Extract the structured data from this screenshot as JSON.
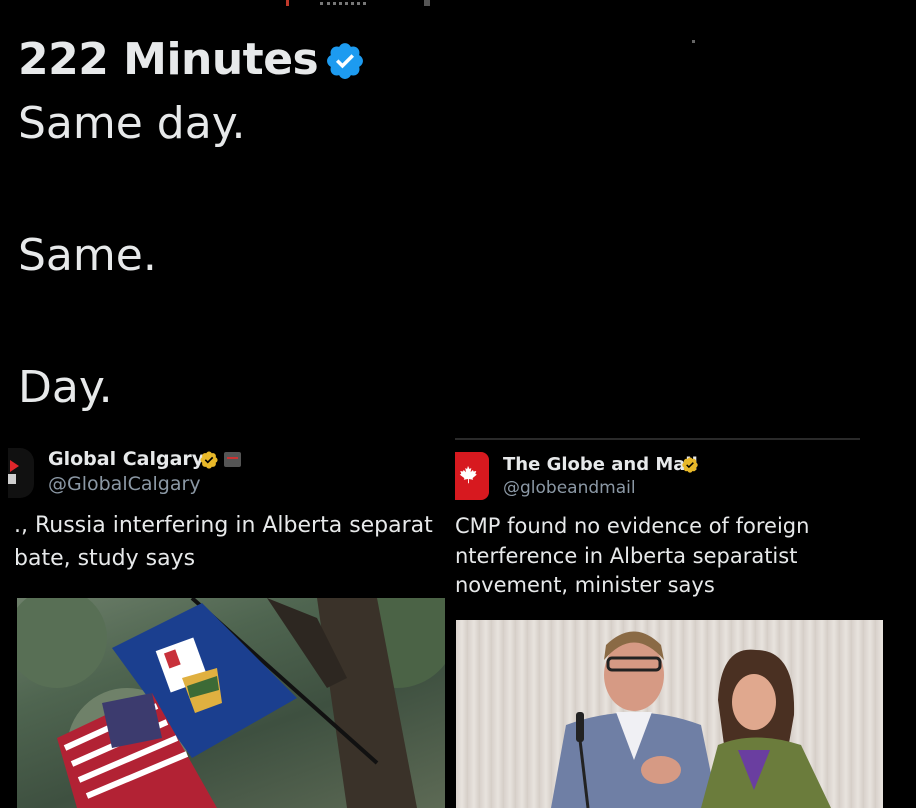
{
  "tweet": {
    "author_name": "222 Minutes",
    "lines": [
      "Same day.",
      "Same.",
      "Day."
    ]
  },
  "cards": {
    "left": {
      "name": "Global Calgary",
      "handle": "@GlobalCalgary",
      "headline_line1": "., Russia interfering in Alberta separat",
      "headline_line2": "bate, study says"
    },
    "right": {
      "name": "The Globe and Mail",
      "handle": "@globeandmail",
      "headline_line1": "CMP found no evidence of foreign",
      "headline_line2": "nterference in Alberta separatist",
      "headline_line3": "novement, minister says"
    }
  },
  "colors": {
    "background": "#000000",
    "text": "#e7e9ea",
    "handle": "#8b98a5",
    "verified_blue": "#1d9bf0",
    "verified_gold": "#e8b829",
    "globe_red": "#d7191f"
  },
  "icons": [
    "verified-badge-icon",
    "verified-gold-badge-icon",
    "news-tag-icon",
    "maple-leaf-icon"
  ]
}
